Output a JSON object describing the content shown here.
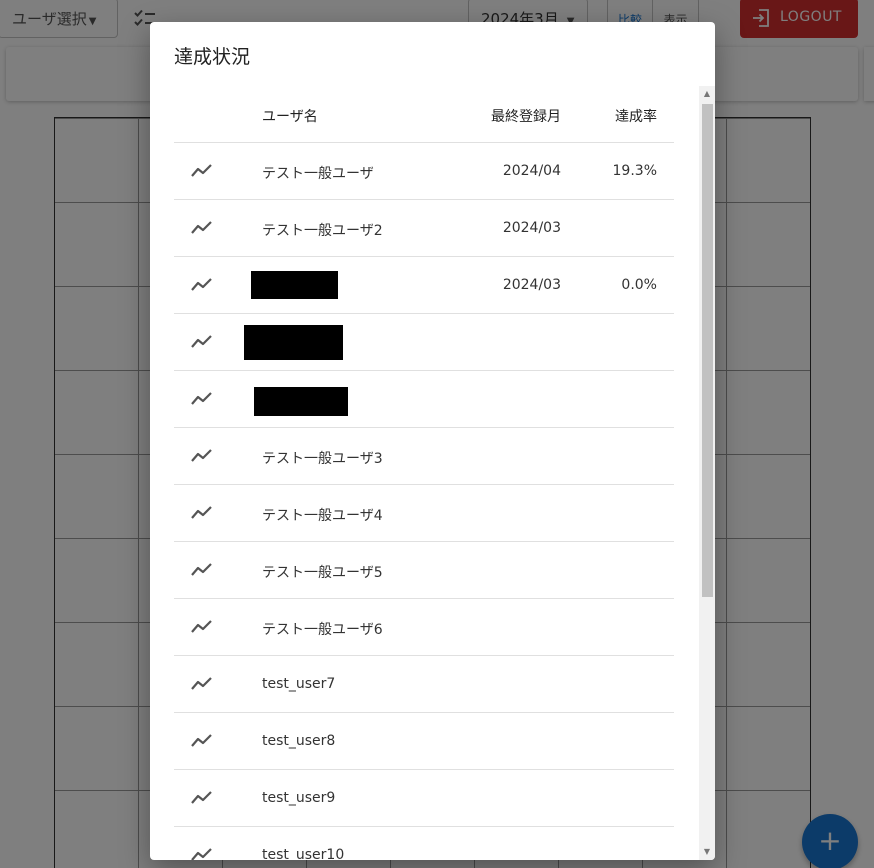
{
  "toolbar": {
    "user_select_label": "ユーザ選択",
    "month_value": "2024年3月",
    "toggle": [
      "比較",
      "表示"
    ],
    "logout_label": "LOGOUT"
  },
  "fab_icon": "plus-icon",
  "dialog": {
    "title": "達成状況",
    "columns": {
      "name": "ユーザ名",
      "last_month": "最終登録月",
      "rate": "達成率"
    },
    "rows": [
      {
        "name": "テスト一般ユーザ",
        "last_month": "2024/04",
        "rate": "19.3%"
      },
      {
        "name": "テスト一般ユーザ2",
        "last_month": "2024/03",
        "rate": ""
      },
      {
        "name": "",
        "last_month": "2024/03",
        "rate": "0.0%",
        "redacted": true
      },
      {
        "name": "",
        "last_month": "",
        "rate": "",
        "redacted": true
      },
      {
        "name": "",
        "last_month": "",
        "rate": "",
        "redacted": true
      },
      {
        "name": "テスト一般ユーザ3",
        "last_month": "",
        "rate": ""
      },
      {
        "name": "テスト一般ユーザ4",
        "last_month": "",
        "rate": ""
      },
      {
        "name": "テスト一般ユーザ5",
        "last_month": "",
        "rate": ""
      },
      {
        "name": "テスト一般ユーザ6",
        "last_month": "",
        "rate": ""
      },
      {
        "name": "test_user7",
        "last_month": "",
        "rate": ""
      },
      {
        "name": "test_user8",
        "last_month": "",
        "rate": ""
      },
      {
        "name": "test_user9",
        "last_month": "",
        "rate": ""
      },
      {
        "name": "test_user10",
        "last_month": "",
        "rate": ""
      }
    ]
  },
  "colors": {
    "logout": "#d32f2f",
    "fab": "#1976d2",
    "overlay": "rgba(0,0,0,0.5)"
  }
}
